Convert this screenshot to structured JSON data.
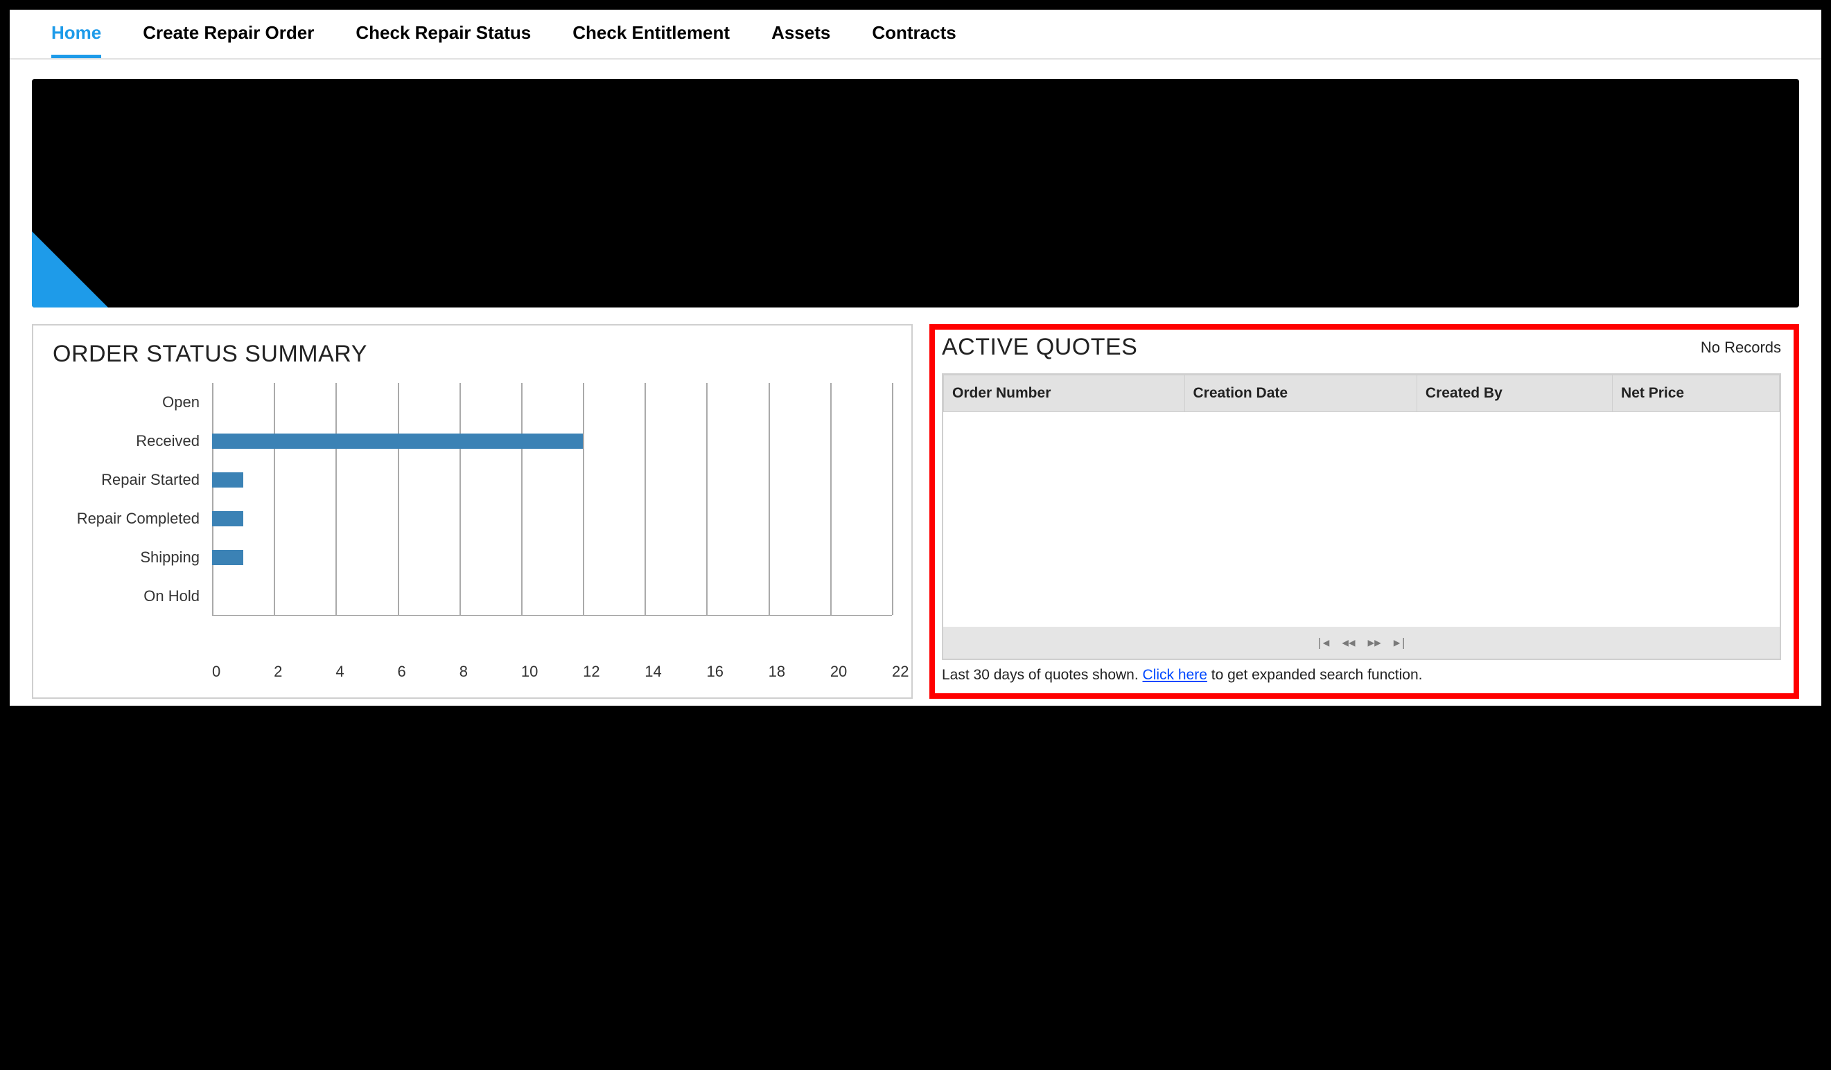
{
  "tabs": [
    {
      "label": "Home",
      "active": true
    },
    {
      "label": "Create Repair Order",
      "active": false
    },
    {
      "label": "Check Repair Status",
      "active": false
    },
    {
      "label": "Check Entitlement",
      "active": false
    },
    {
      "label": "Assets",
      "active": false
    },
    {
      "label": "Contracts",
      "active": false
    }
  ],
  "order_summary": {
    "title": "ORDER STATUS SUMMARY"
  },
  "active_quotes": {
    "title": "ACTIVE QUOTES",
    "no_records": "No Records",
    "columns": [
      "Order Number",
      "Creation Date",
      "Created By",
      "Net Price"
    ],
    "footer_pre": "Last 30 days of quotes shown. ",
    "footer_link": "Click here",
    "footer_post": " to get expanded search function."
  },
  "chart_data": {
    "type": "bar",
    "orientation": "horizontal",
    "categories": [
      "Open",
      "Received",
      "Repair Started",
      "Repair Completed",
      "Shipping",
      "On Hold"
    ],
    "values": [
      0,
      12,
      1,
      1,
      1,
      0
    ],
    "xlabel": "",
    "ylabel": "",
    "xlim": [
      0,
      22
    ],
    "xticks": [
      0,
      2,
      4,
      6,
      8,
      10,
      12,
      14,
      16,
      18,
      20,
      22
    ]
  }
}
